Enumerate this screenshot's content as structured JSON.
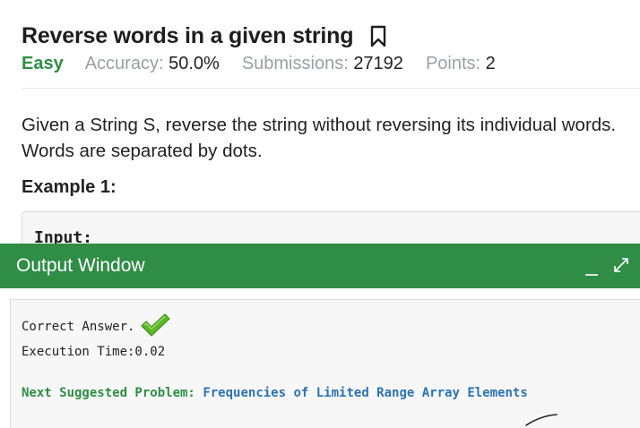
{
  "problem": {
    "title": "Reverse words in a given string",
    "difficulty": "Easy",
    "accuracy_label": "Accuracy:",
    "accuracy_value": "50.0%",
    "submissions_label": "Submissions:",
    "submissions_value": "27192",
    "points_label": "Points:",
    "points_value": "2",
    "description": "Given a String S, reverse the string without reversing its individual words. Words are separated by dots.",
    "example_heading": "Example 1:",
    "example_input_label": "Input:",
    "bookmark_icon": "bookmark-icon"
  },
  "output_window": {
    "title": "Output Window",
    "result_text": "Correct Answer.",
    "execution_time": "Execution Time:0.02",
    "suggest_label": "Next Suggested Problem:",
    "suggest_link": "Frequencies of Limited Range Array Elements",
    "icons": [
      "minimize-icon",
      "expand-icon",
      "check-icon"
    ]
  },
  "colors": {
    "accent_green": "#2f8d46",
    "link_blue": "#2c73b2",
    "muted_gray": "#9aa0a6"
  }
}
